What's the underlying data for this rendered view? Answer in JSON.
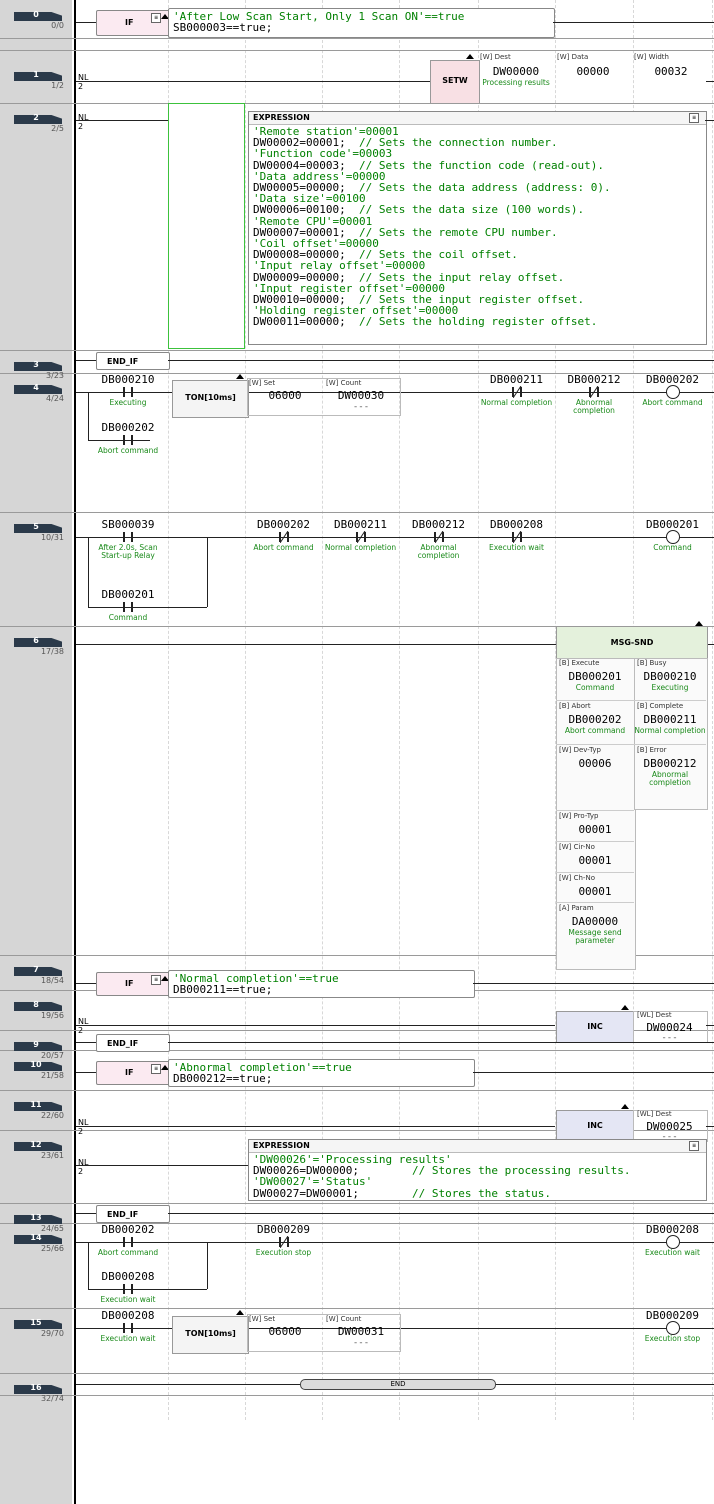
{
  "rungs": [
    {
      "num": "0",
      "step": "0/0"
    },
    {
      "num": "1",
      "step": "1/2"
    },
    {
      "num": "2",
      "step": "2/5"
    },
    {
      "num": "3",
      "step": "3/23"
    },
    {
      "num": "4",
      "step": "4/24"
    },
    {
      "num": "5",
      "step": "10/31"
    },
    {
      "num": "6",
      "step": "17/38"
    },
    {
      "num": "7",
      "step": "18/54"
    },
    {
      "num": "8",
      "step": "19/56"
    },
    {
      "num": "9",
      "step": "20/57"
    },
    {
      "num": "10",
      "step": "21/58"
    },
    {
      "num": "11",
      "step": "22/60"
    },
    {
      "num": "12",
      "step": "23/61"
    },
    {
      "num": "13",
      "step": "24/65"
    },
    {
      "num": "14",
      "step": "25/66"
    },
    {
      "num": "15",
      "step": "29/70"
    },
    {
      "num": "16",
      "step": "32/74"
    }
  ],
  "nl": {
    "label": "NL",
    "value": "2"
  },
  "if_label": "IF",
  "endif_label": "END_IF",
  "rung0": {
    "comment": "'After Low Scan Start, Only 1 Scan ON'==true",
    "expr": "SB000003==true;"
  },
  "rung1": {
    "instr": "SETW",
    "dest_lbl": "[W] Dest",
    "dest_val": "DW00000",
    "dest_cap": "Processing results",
    "data_lbl": "[W] Data",
    "data_val": "00000",
    "width_lbl": "[W] Width",
    "width_val": "00032"
  },
  "rung2": {
    "title": "EXPRESSION",
    "lines": [
      {
        "c": "'Remote station'=00001",
        "code": "",
        "cmt": ""
      },
      {
        "c": "",
        "code": "DW00002=00001;  ",
        "cmt": "// Sets the connection number."
      },
      {
        "c": "'Function code'=00003",
        "code": "",
        "cmt": ""
      },
      {
        "c": "",
        "code": "DW00004=00003;  ",
        "cmt": "// Sets the function code (read-out)."
      },
      {
        "c": "'Data address'=00000",
        "code": "",
        "cmt": ""
      },
      {
        "c": "",
        "code": "DW00005=00000;  ",
        "cmt": "// Sets the data address (address: 0)."
      },
      {
        "c": "'Data size'=00100",
        "code": "",
        "cmt": ""
      },
      {
        "c": "",
        "code": "DW00006=00100;  ",
        "cmt": "// Sets the data size (100 words)."
      },
      {
        "c": "'Remote CPU'=00001",
        "code": "",
        "cmt": ""
      },
      {
        "c": "",
        "code": "DW00007=00001;  ",
        "cmt": "// Sets the remote CPU number."
      },
      {
        "c": "'Coil offset'=00000",
        "code": "",
        "cmt": ""
      },
      {
        "c": "",
        "code": "DW00008=00000;  ",
        "cmt": "// Sets the coil offset."
      },
      {
        "c": "'Input relay offset'=00000",
        "code": "",
        "cmt": ""
      },
      {
        "c": "",
        "code": "DW00009=00000;  ",
        "cmt": "// Sets the input relay offset."
      },
      {
        "c": "'Input register offset'=00000",
        "code": "",
        "cmt": ""
      },
      {
        "c": "",
        "code": "DW00010=00000;  ",
        "cmt": "// Sets the input register offset."
      },
      {
        "c": "'Holding register offset'=00000",
        "code": "",
        "cmt": ""
      },
      {
        "c": "",
        "code": "DW00011=00000;  ",
        "cmt": "// Sets the holding register offset."
      }
    ]
  },
  "rung4": {
    "c1": "DB000210",
    "c1cap": "Executing",
    "ton": "TON[10ms]",
    "set_lbl": "[W] Set",
    "set_val": "06000",
    "count_lbl": "[W] Count",
    "count_val": "DW00030",
    "count_sub": "---",
    "c2": "DB000211",
    "c2cap": "Normal completion",
    "c3": "DB000212",
    "c3cap": "Abnormal completion",
    "coil": "DB000202",
    "coilcap": "Abort command",
    "c4": "DB000202",
    "c4cap": "Abort command"
  },
  "rung5": {
    "c1": "SB000039",
    "c1cap": "After 2.0s, Scan Start-up Relay",
    "c2": "DB000202",
    "c2cap": "Abort command",
    "c3": "DB000211",
    "c3cap": "Normal completion",
    "c4": "DB000212",
    "c4cap": "Abnormal completion",
    "c5": "DB000208",
    "c5cap": "Execution wait",
    "coil": "DB000201",
    "coilcap": "Command",
    "c6": "DB000201",
    "c6cap": "Command"
  },
  "rung6": {
    "title": "MSG-SND",
    "pins": [
      {
        "l": "[B] Execute",
        "v": "DB000201",
        "c": "Command"
      },
      {
        "l": "[B] Abort",
        "v": "DB000202",
        "c": "Abort command"
      },
      {
        "l": "[W] Dev-Typ",
        "v": "00006",
        "c": ""
      },
      {
        "l": "[W] Pro-Typ",
        "v": "00001",
        "c": ""
      },
      {
        "l": "[W] Cir-No",
        "v": "00001",
        "c": ""
      },
      {
        "l": "[W] Ch-No",
        "v": "00001",
        "c": ""
      },
      {
        "l": "[A] Param",
        "v": "DA00000",
        "c": "Message send parameter"
      }
    ],
    "outs": [
      {
        "l": "[B] Busy",
        "v": "DB000210",
        "c": "Executing"
      },
      {
        "l": "[B] Complete",
        "v": "DB000211",
        "c": "Normal completion"
      },
      {
        "l": "[B] Error",
        "v": "DB000212",
        "c": "Abnormal completion"
      }
    ]
  },
  "rung7": {
    "comment": "'Normal completion'==true",
    "expr": "DB000211==true;"
  },
  "rung8": {
    "instr": "INC",
    "dest_lbl": "[WL] Dest",
    "dest_val": "DW00024",
    "dest_sub": "---"
  },
  "rung10": {
    "comment": "'Abnormal completion'==true",
    "expr": "DB000212==true;"
  },
  "rung11": {
    "instr": "INC",
    "dest_lbl": "[WL] Dest",
    "dest_val": "DW00025",
    "dest_sub": "---"
  },
  "rung12": {
    "title": "EXPRESSION",
    "lines": [
      {
        "c": "'DW00026'='Processing results'",
        "code": "",
        "cmt": ""
      },
      {
        "c": "",
        "code": "DW00026=DW00000;        ",
        "cmt": "// Stores the processing results."
      },
      {
        "c": "'DW00027'='Status'",
        "code": "",
        "cmt": ""
      },
      {
        "c": "",
        "code": "DW00027=DW00001;        ",
        "cmt": "// Stores the status."
      }
    ]
  },
  "rung14": {
    "c1": "DB000202",
    "c1cap": "Abort command",
    "c2": "DB000209",
    "c2cap": "Execution stop",
    "coil": "DB000208",
    "coilcap": "Execution wait",
    "c3": "DB000208",
    "c3cap": "Execution wait"
  },
  "rung15": {
    "c1": "DB000208",
    "c1cap": "Execution wait",
    "ton": "TON[10ms]",
    "set_lbl": "[W] Set",
    "set_val": "06000",
    "count_lbl": "[W] Count",
    "count_val": "DW00031",
    "count_sub": "---",
    "coil": "DB000209",
    "coilcap": "Execution stop"
  },
  "rung16": {
    "end": "END"
  }
}
